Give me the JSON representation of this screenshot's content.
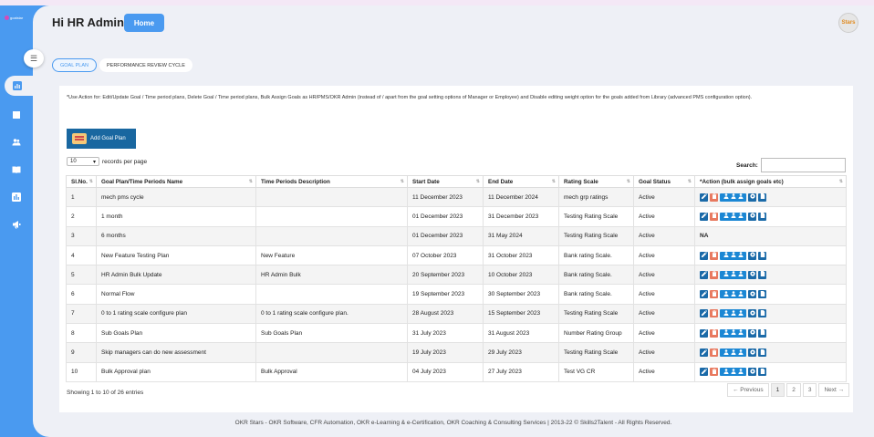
{
  "app": {
    "logo_text": "goalstar",
    "greeting": "Hi HR Admin",
    "home_label": "Home",
    "avatar_text": "Stars"
  },
  "tabs": [
    {
      "label": "GOAL PLAN",
      "active": true
    },
    {
      "label": "PERFORMANCE REVIEW CYCLE",
      "active": false
    }
  ],
  "note": "*Use Action for: Edit/Update Goal / Time period plans, Delete Goal / Time period plans, Bulk Assign Goals as HR/PMS/OKR Admin (instead of / apart from the goal setting options of Manager or Employee) and Disable editing weight option for the goals added from Library (advanced PMS configuration option).",
  "add_button_label": "Add Goal Plan",
  "records": {
    "value": "10",
    "suffix": "records per page"
  },
  "search": {
    "label": "Search:",
    "value": ""
  },
  "table": {
    "headers": [
      "Sl.No.",
      "Goal Plan/Time Periods Name",
      "Time Periods Description",
      "Start Date",
      "End Date",
      "Rating Scale",
      "Goal Status",
      "*Action (bulk assign goals etc)"
    ],
    "rows": [
      {
        "no": "1",
        "name": "mech pms cycle",
        "desc": "",
        "start": "11 December 2023",
        "end": "11 December 2024",
        "scale": "mech grp ratings",
        "status": "Active",
        "action": ""
      },
      {
        "no": "2",
        "name": "1 month",
        "desc": "",
        "start": "01 December 2023",
        "end": "31 December 2023",
        "scale": "Testing Rating Scale",
        "status": "Active",
        "action": ""
      },
      {
        "no": "3",
        "name": "6 months",
        "desc": "",
        "start": "01 December 2023",
        "end": "31 May 2024",
        "scale": "Testing Rating Scale",
        "status": "Active",
        "action": "NA"
      },
      {
        "no": "4",
        "name": "New Feature Testing Plan",
        "desc": "New Feature",
        "start": "07 October 2023",
        "end": "31 October 2023",
        "scale": "Bank rating Scale.",
        "status": "Active",
        "action": ""
      },
      {
        "no": "5",
        "name": "HR Admin Bulk Update",
        "desc": "HR Admin Bulk",
        "start": "20 September 2023",
        "end": "10 October 2023",
        "scale": "Bank rating Scale.",
        "status": "Active",
        "action": ""
      },
      {
        "no": "6",
        "name": "Normal Flow",
        "desc": "",
        "start": "19 September 2023",
        "end": "30 September 2023",
        "scale": "Bank rating Scale.",
        "status": "Active",
        "action": ""
      },
      {
        "no": "7",
        "name": "0 to 1 rating scale configure plan",
        "desc": "0 to 1 rating scale configure plan.",
        "start": "28 August 2023",
        "end": "15 September 2023",
        "scale": "Testing Rating Scale",
        "status": "Active",
        "action": ""
      },
      {
        "no": "8",
        "name": "Sub Goals Plan",
        "desc": "Sub Goals Plan",
        "start": "31 July 2023",
        "end": "31 August 2023",
        "scale": "Number Rating Group",
        "status": "Active",
        "action": ""
      },
      {
        "no": "9",
        "name": "Skip managers can do new assessment",
        "desc": "",
        "start": "19 July 2023",
        "end": "29 July 2023",
        "scale": "Testing Rating Scale",
        "status": "Active",
        "action": ""
      },
      {
        "no": "10",
        "name": "Bulk Approval plan",
        "desc": "Bulk Approval",
        "start": "04 July 2023",
        "end": "27 July 2023",
        "scale": "Test VG CR",
        "status": "Active",
        "action": ""
      }
    ]
  },
  "showing": "Showing 1 to 10 of 26 entries",
  "pagination": {
    "previous": "← Previous",
    "pages": [
      "1",
      "2",
      "3"
    ],
    "current": "1",
    "next": "Next →"
  },
  "footer": "OKR Stars - OKR Software, CFR Automation, OKR e-Learning & e-Certification, OKR Coaching & Consulting Services | 2013-22 © Skills2Talent - All Rights Reserved.",
  "icons": {
    "sidebar": [
      "chart-icon",
      "book-icon",
      "users-icon",
      "book-open-icon",
      "bar-chart-icon",
      "megaphone-icon"
    ]
  },
  "colors": {
    "brand": "#4a9af0",
    "action_dark": "#1b6aa8",
    "action_delete": "#e8795f"
  }
}
